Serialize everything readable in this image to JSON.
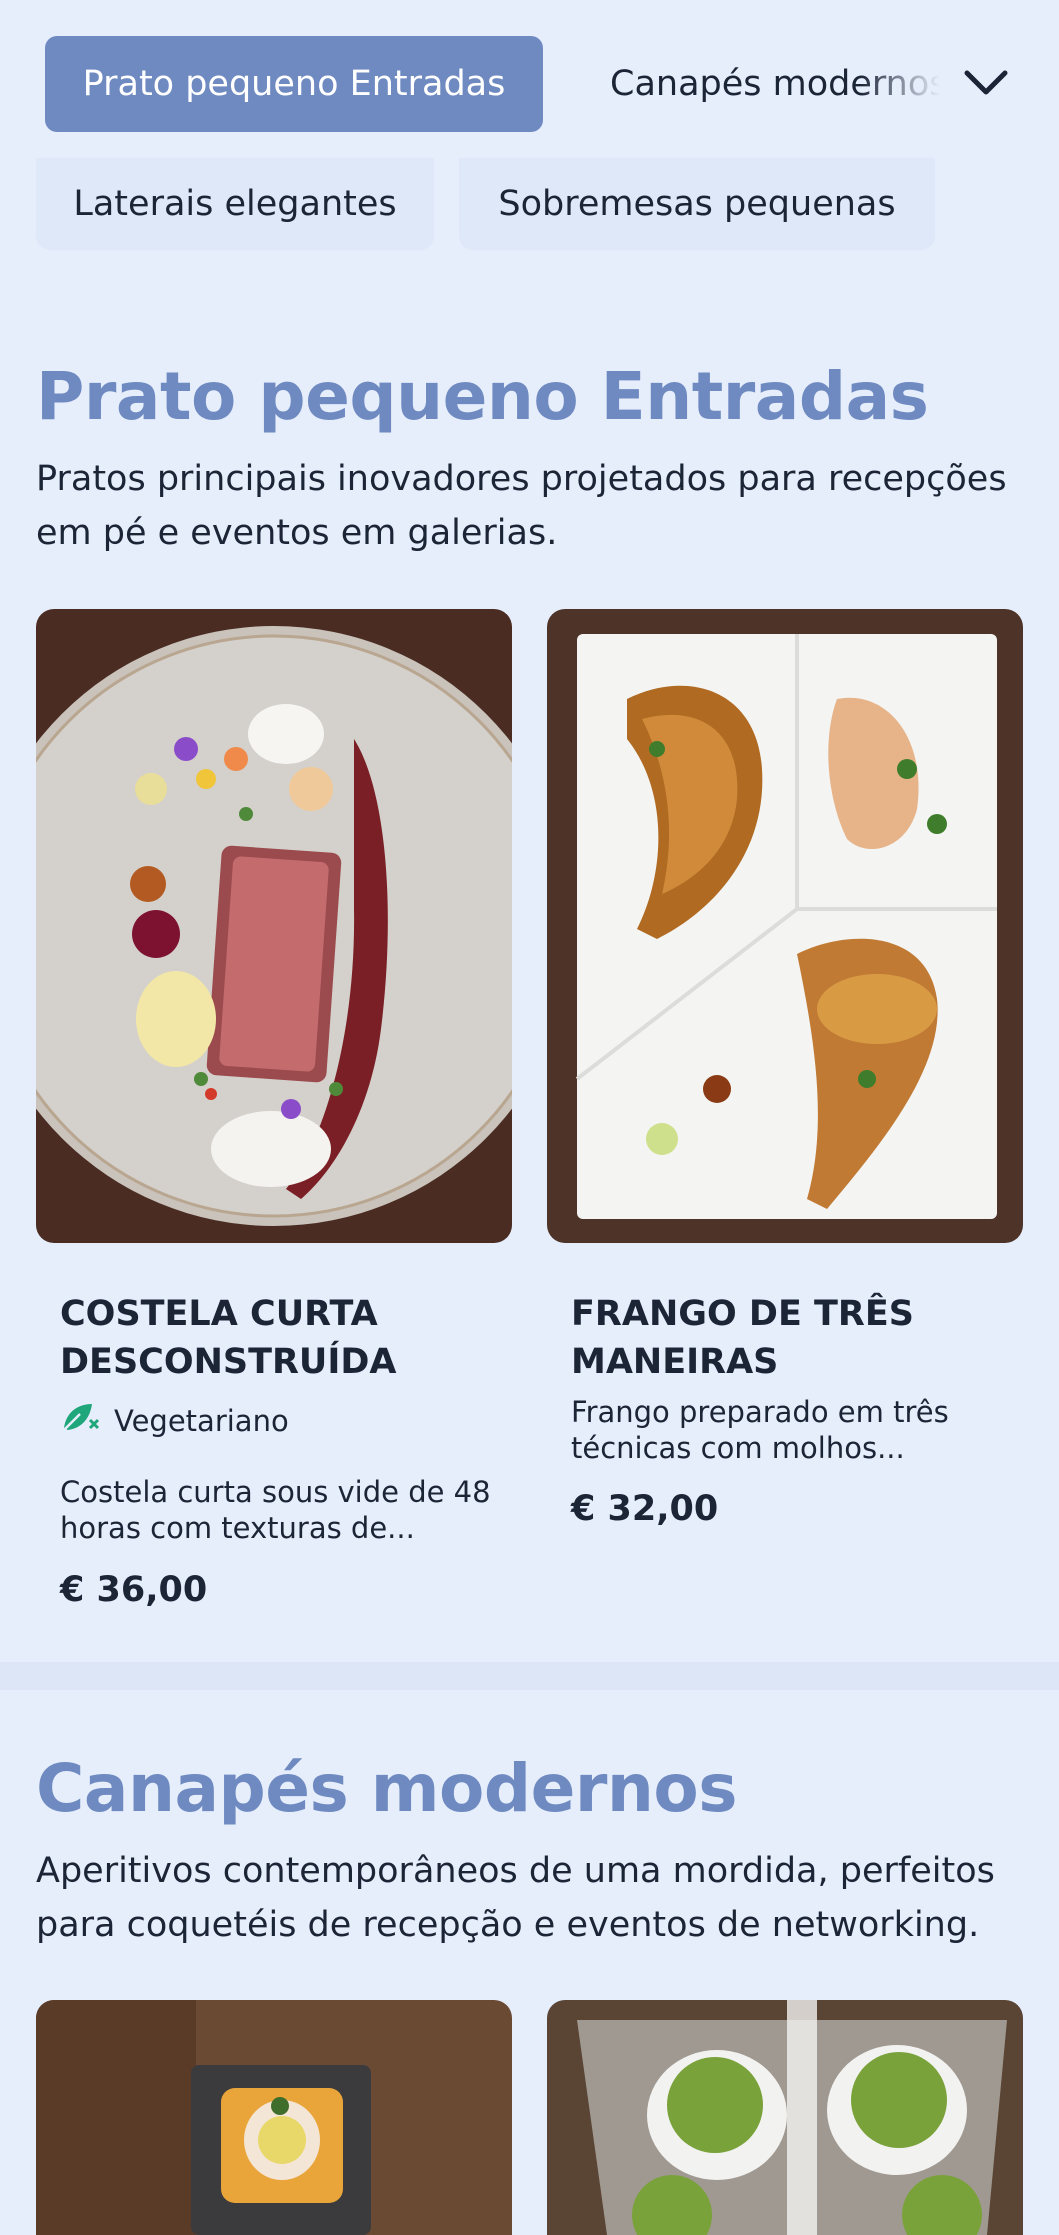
{
  "nav": {
    "active_category": "Prato pequeno Entradas",
    "next_category": "Canapés modernos",
    "row2": [
      "Laterais elegantes",
      "Sobremesas pequenas"
    ],
    "dropdown_icon": "chevron-down-icon"
  },
  "sections": [
    {
      "title": "Prato pequeno Entradas",
      "description": "Pratos principais inovadores projetados para recepções em pé e eventos em galerias.",
      "items": [
        {
          "name": "COSTELA CURTA DESCONSTRUÍDA",
          "badge": "Vegetariano",
          "badge_icon": "leaf-vegetarian-icon",
          "description": "Costela curta sous vide de 48 horas com texturas de...",
          "price": "€ 36,00"
        },
        {
          "name": "FRANGO DE TRÊS MANEIRAS",
          "description": "Frango preparado em três técnicas com molhos...",
          "price": "€ 32,00"
        }
      ]
    },
    {
      "title": "Canapés modernos",
      "description": "Aperitivos contemporâneos de uma mordida, perfeitos para coquetéis de recepção e eventos de networking."
    }
  ],
  "colors": {
    "background": "#e6eefc",
    "accent": "#6f8ac1",
    "text": "#1c2536",
    "badge_green": "#1fa67a"
  }
}
